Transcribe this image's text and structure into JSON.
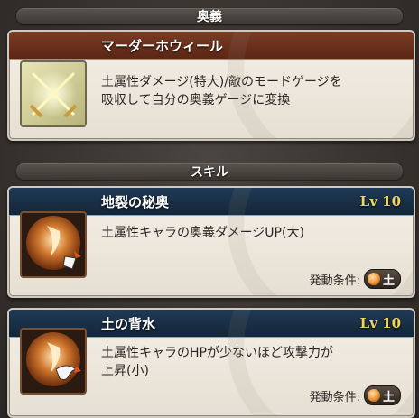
{
  "sections": {
    "ougi_header": "奥義",
    "skill_header": "スキル"
  },
  "ougi": {
    "name": "マーダーホウィール",
    "description_line1": "土属性ダメージ(特大)/敵のモードゲージを",
    "description_line2": "吸収して自分の奥義ゲージに変換",
    "icon": "crossed-swords-icon"
  },
  "skills": [
    {
      "name": "地裂の秘奥",
      "level": "Lv 10",
      "description_line1": "土属性キャラの奥義ダメージUP(大)",
      "description_line2": "",
      "condition_label": "発動条件:",
      "element": "土",
      "icon": "earth-skill-icon"
    },
    {
      "name": "土の背水",
      "level": "Lv 10",
      "description_line1": "土属性キャラのHPが少ないほど攻撃力が",
      "description_line2": "上昇(小)",
      "condition_label": "発動条件:",
      "element": "土",
      "icon": "earth-backwater-icon"
    }
  ],
  "colors": {
    "ougi_title_bg": "#6b301b",
    "skill_title_bg": "#1a3048",
    "level_text": "#f2d45c",
    "element_orb": "#e58a2a"
  }
}
